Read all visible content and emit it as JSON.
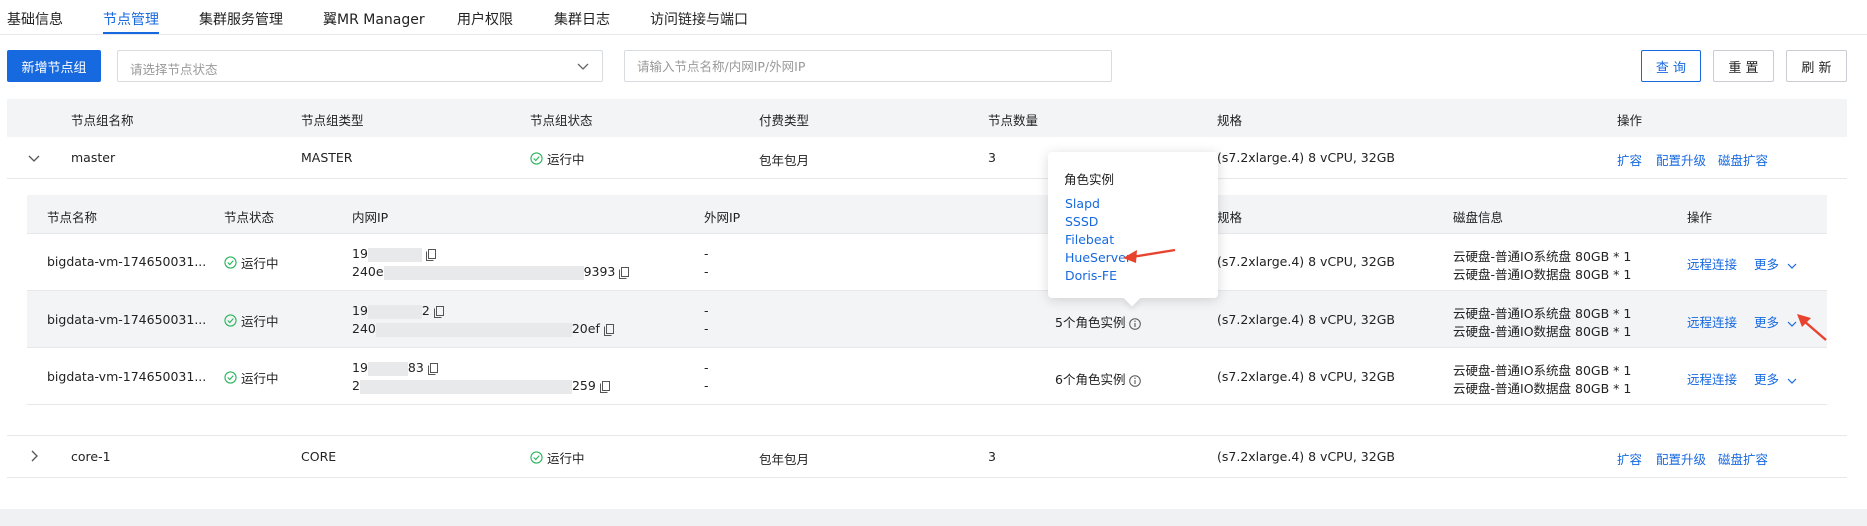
{
  "tabs": [
    {
      "label": "基础信息"
    },
    {
      "label": "节点管理"
    },
    {
      "label": "集群服务管理"
    },
    {
      "label": "翼MR Manager"
    },
    {
      "label": "用户权限"
    },
    {
      "label": "集群日志"
    },
    {
      "label": "访问链接与端口"
    }
  ],
  "active_tab": "节点管理",
  "toolbar": {
    "add_label": "新增节点组",
    "status_placeholder": "请选择节点状态",
    "search_placeholder": "请输入节点名称/内网IP/外网IP",
    "query_label": "查 询",
    "reset_label": "重 置",
    "refresh_label": "刷 新"
  },
  "group_table": {
    "headers": [
      "节点组名称",
      "节点组类型",
      "节点组状态",
      "付费类型",
      "节点数量",
      "规格",
      "操作"
    ],
    "rows": [
      {
        "name": "master",
        "type": "MASTER",
        "status": "运行中",
        "billing": "包年包月",
        "count": "3",
        "spec": "(s7.2xlarge.4) 8 vCPU, 32GB",
        "actions": [
          "扩容",
          "配置升级",
          "磁盘扩容"
        ]
      },
      {
        "name": "core-1",
        "type": "CORE",
        "status": "运行中",
        "billing": "包年包月",
        "count": "3",
        "spec": "(s7.2xlarge.4) 8 vCPU, 32GB",
        "actions": [
          "扩容",
          "配置升级",
          "磁盘扩容"
        ]
      }
    ]
  },
  "node_table": {
    "headers": [
      "节点名称",
      "节点状态",
      "内网IP",
      "外网IP",
      "规格",
      "磁盘信息",
      "操作"
    ],
    "rows": [
      {
        "name": "bigdata-vm-174650031...",
        "status": "运行中",
        "ip1_start": "19",
        "ip1_end": "",
        "ip2_start": "240e",
        "ip2_end": "9393",
        "ext1": "-",
        "ext2": "-",
        "roles": "",
        "spec": "(s7.2xlarge.4) 8 vCPU, 32GB",
        "disk1": "云硬盘-普通IO系统盘 80GB * 1",
        "disk2": "云硬盘-普通IO数据盘 80GB * 1",
        "remote": "远程连接",
        "more": "更多"
      },
      {
        "name": "bigdata-vm-174650031...",
        "status": "运行中",
        "ip1_start": "19",
        "ip1_end": "2",
        "ip2_start": "240",
        "ip2_end": "20ef",
        "ext1": "-",
        "ext2": "-",
        "roles": "5个角色实例",
        "spec": "(s7.2xlarge.4) 8 vCPU, 32GB",
        "disk1": "云硬盘-普通IO系统盘 80GB * 1",
        "disk2": "云硬盘-普通IO数据盘 80GB * 1",
        "remote": "远程连接",
        "more": "更多"
      },
      {
        "name": "bigdata-vm-174650031...",
        "status": "运行中",
        "ip1_start": "19",
        "ip1_end": "83",
        "ip2_start": "2",
        "ip2_end": "259",
        "ext1": "-",
        "ext2": "-",
        "roles": "6个角色实例",
        "spec": "(s7.2xlarge.4) 8 vCPU, 32GB",
        "disk1": "云硬盘-普通IO系统盘 80GB * 1",
        "disk2": "云硬盘-普通IO数据盘 80GB * 1",
        "remote": "远程连接",
        "more": "更多"
      }
    ]
  },
  "popover": {
    "title": "角色实例",
    "items": [
      "Slapd",
      "SSSD",
      "Filebeat",
      "HueServer",
      "Doris-FE"
    ]
  },
  "colors": {
    "accent": "#1769e0",
    "success": "#2bb55e",
    "annotation_arrow": "#e8432e"
  }
}
